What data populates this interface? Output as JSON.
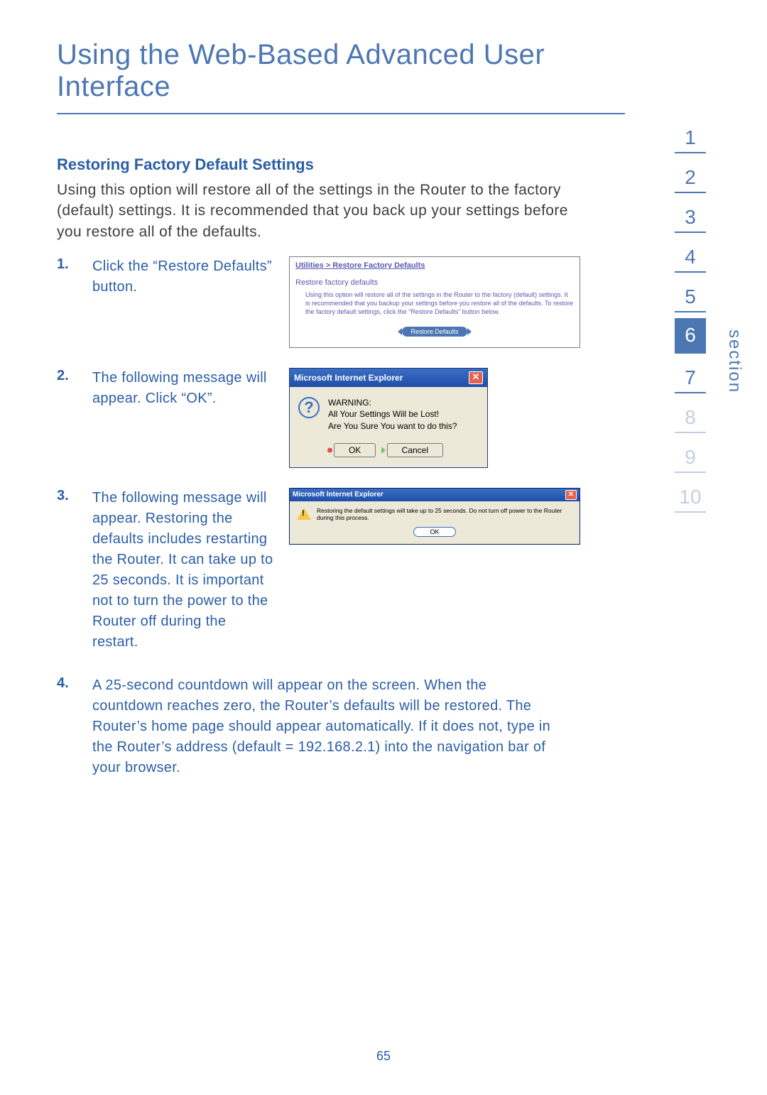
{
  "title": "Using the Web-Based Advanced User Interface",
  "subhead": "Restoring Factory Default Settings",
  "intro": "Using this option will restore all of the settings in the Router to the factory (default) settings. It is recommended that you back up your settings before you restore all of the defaults.",
  "steps": {
    "s1": {
      "num": "1.",
      "text": "Click the “Restore Defaults” button."
    },
    "s2": {
      "num": "2.",
      "text": "The following message will appear. Click “OK”."
    },
    "s3": {
      "num": "3.",
      "text": "The following message will appear. Restoring the defaults includes restarting the Router. It can take up to 25 seconds. It is important not to turn the power to the Router off during the restart."
    },
    "s4": {
      "num": "4.",
      "text": "A 25-second countdown will appear on the screen. When the countdown reaches zero, the Router’s defaults will be restored. The Router’s home page should appear automatically. If it does not, type in the Router’s address (default = 192.168.2.1) into the navigation bar of your browser."
    }
  },
  "util_panel": {
    "breadcrumb": "Utilities > Restore Factory Defaults",
    "subtitle": "Restore factory defaults",
    "description": "Using this option will restore all of the settings in the Router to the factory (default) settings. It is recommended that you backup your settings before you restore all of the defaults. To restore the factory default settings, click the “Restore Defaults” button below.",
    "button": "Restore Defaults"
  },
  "ie_confirm": {
    "title": "Microsoft Internet Explorer",
    "line1": "WARNING:",
    "line2": "All Your Settings Will be Lost!",
    "line3": "Are You Sure You want to do this?",
    "ok": "OK",
    "cancel": "Cancel"
  },
  "ie_alert": {
    "title": "Microsoft Internet Explorer",
    "message": "Restoring the default settings will take up to 25 seconds. Do not turn off power to the Router during this process.",
    "ok": "OK"
  },
  "sidebar": {
    "label": "section",
    "items": [
      "1",
      "2",
      "3",
      "4",
      "5",
      "6",
      "7",
      "8",
      "9",
      "10"
    ],
    "active_index": 5
  },
  "page_number": "65"
}
